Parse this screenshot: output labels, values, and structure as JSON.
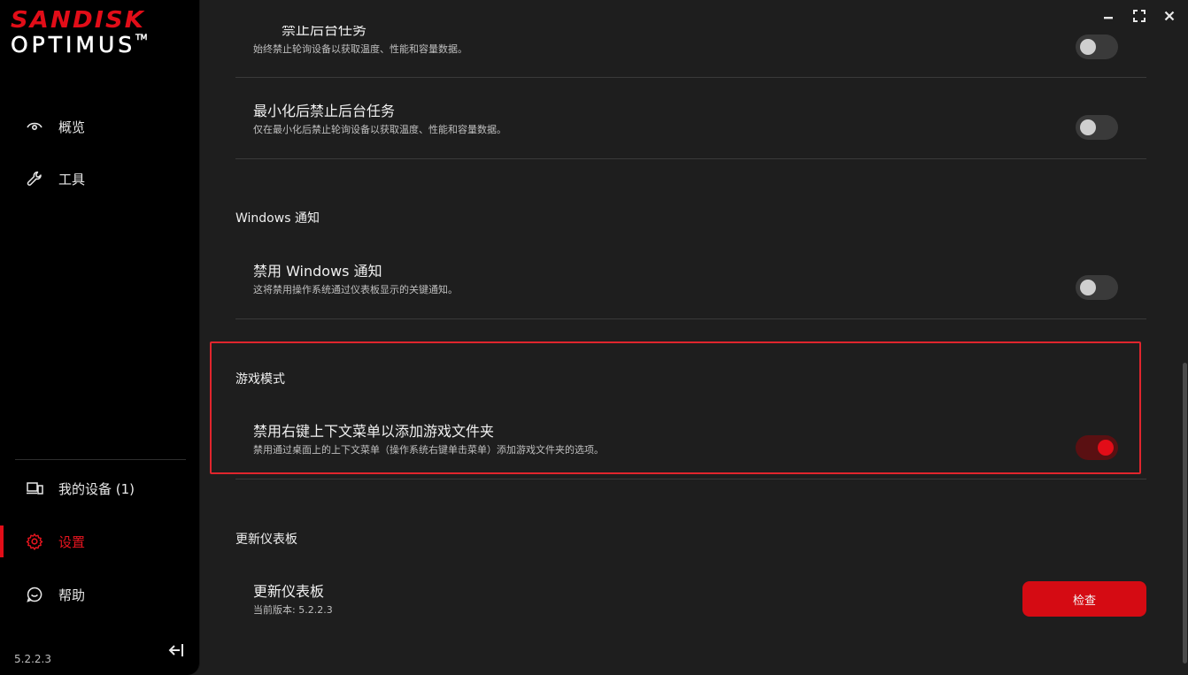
{
  "brand": {
    "top": "SANDISK",
    "bottom": "OPTIMUS",
    "tm": "TM",
    "accent_color": "#e20d18"
  },
  "sidebar": {
    "items": [
      {
        "label": "概览",
        "icon": "eye-icon"
      },
      {
        "label": "工具",
        "icon": "wrench-icon"
      }
    ],
    "bottom_items": [
      {
        "label": "我的设备 (1)",
        "icon": "devices-icon"
      },
      {
        "label": "设置",
        "icon": "gear-icon",
        "active": true
      },
      {
        "label": "帮助",
        "icon": "help-chat-icon"
      }
    ],
    "version": "5.2.2.3"
  },
  "window_controls": [
    "minimize-icon",
    "maximize-icon",
    "close-icon"
  ],
  "settings": {
    "polling": {
      "partial_title": "禁止后台任务",
      "desc": "始终禁止轮询设备以获取温度、性能和容量数据。",
      "enabled": false
    },
    "minimize": {
      "title": "最小化后禁止后台任务",
      "desc": "仅在最小化后禁止轮询设备以获取温度、性能和容量数据。",
      "enabled": false
    },
    "windows_notify": {
      "section": "Windows 通知",
      "title": "禁用 Windows 通知",
      "desc": "这将禁用操作系统通过仪表板显示的关键通知。",
      "enabled": false
    },
    "game_mode": {
      "section": "游戏模式",
      "title": "禁用右键上下文菜单以添加游戏文件夹",
      "desc": "禁用通过桌面上的上下文菜单（操作系统右键单击菜单）添加游戏文件夹的选项。",
      "enabled": true
    },
    "update": {
      "section": "更新仪表板",
      "title": "更新仪表板",
      "desc": "当前版本: 5.2.2.3",
      "button": "检查"
    }
  }
}
